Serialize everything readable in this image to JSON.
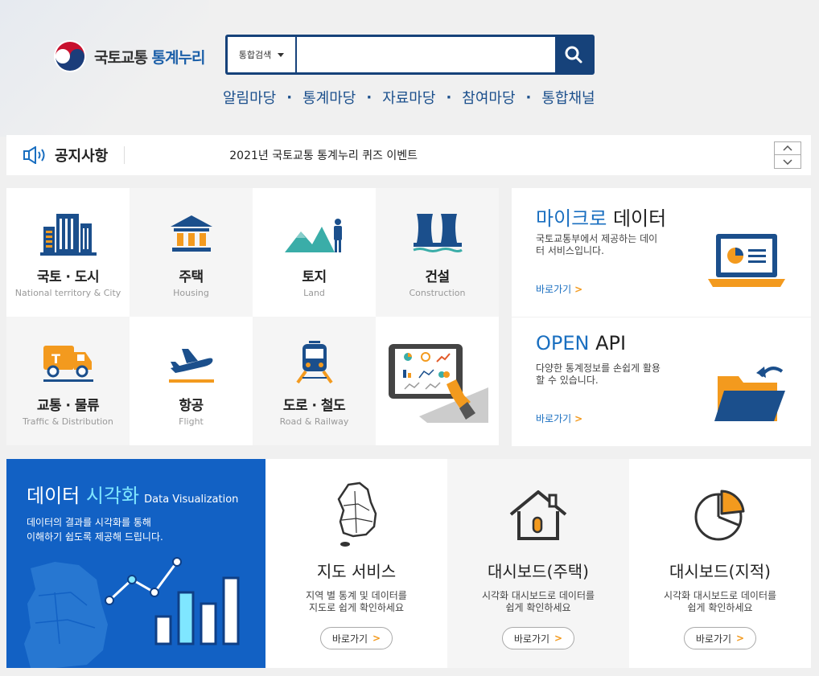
{
  "header": {
    "logo_text_dark": "국토교통",
    "logo_text_blue": "통계누리",
    "search": {
      "select_label": "통합검색",
      "placeholder": ""
    },
    "nav": [
      "알림마당",
      "통계마당",
      "자료마당",
      "참여마당",
      "통합채널"
    ],
    "nav_separator": "·"
  },
  "notice": {
    "title": "공지사항",
    "text": "2021년 국토교통 통계누리 퀴즈 이벤트"
  },
  "categories": [
    {
      "title": "국토 · 도시",
      "sub": "National territory & City"
    },
    {
      "title": "주택",
      "sub": "Housing"
    },
    {
      "title": "토지",
      "sub": "Land"
    },
    {
      "title": "건설",
      "sub": "Construction"
    },
    {
      "title": "교통 · 물류",
      "sub": "Traffic & Distribution"
    },
    {
      "title": "항공",
      "sub": "Flight"
    },
    {
      "title": "도로 · 철도",
      "sub": "Road & Railway"
    }
  ],
  "panels": {
    "micro": {
      "title_hl": "마이크로",
      "title_rest": " 데이터",
      "desc": "국토교통부에서 제공하는 데이터 서비스입니다.",
      "link": "바로가기",
      "link_chev": ">"
    },
    "api": {
      "title_hl": "OPEN",
      "title_rest": " API",
      "desc": "다양한 통계정보를 손쉽게 활용 할 수 있습니다.",
      "link": "바로가기",
      "link_chev": ">"
    }
  },
  "dataviz": {
    "title_white": "데이터 ",
    "title_cyan": "시각화",
    "title_en": "Data Visualization",
    "desc_line1": "데이터의 결과를 시각화를 통해",
    "desc_line2": "이해하기 쉽도록 제공해 드립니다."
  },
  "services": [
    {
      "title": "지도 서비스",
      "desc_line1": "지역 별 통계 및 데이터를",
      "desc_line2": "지도로 쉽게 확인하세요",
      "btn": "바로가기",
      "chev": ">"
    },
    {
      "title": "대시보드(주택)",
      "desc_line1": "시각화 대시보드로 데이터를",
      "desc_line2": "쉽게 확인하세요",
      "btn": "바로가기",
      "chev": ">"
    },
    {
      "title": "대시보드(지적)",
      "desc_line1": "시각화 대시보드로 데이터를",
      "desc_line2": "쉽게 확인하세요",
      "btn": "바로가기",
      "chev": ">"
    }
  ],
  "colors": {
    "brand_navy": "#16427a",
    "accent_orange": "#f39a1e",
    "accent_blue": "#1a6fc0",
    "teal": "#3aada8"
  }
}
